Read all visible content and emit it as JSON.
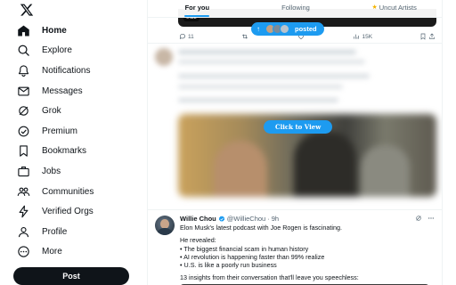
{
  "sidebar": {
    "items": [
      {
        "label": "Home",
        "icon": "home-icon"
      },
      {
        "label": "Explore",
        "icon": "search-icon"
      },
      {
        "label": "Notifications",
        "icon": "bell-icon"
      },
      {
        "label": "Messages",
        "icon": "envelope-icon"
      },
      {
        "label": "Grok",
        "icon": "grok-icon"
      },
      {
        "label": "Premium",
        "icon": "premium-icon"
      },
      {
        "label": "Bookmarks",
        "icon": "bookmark-icon"
      },
      {
        "label": "Jobs",
        "icon": "briefcase-icon"
      },
      {
        "label": "Communities",
        "icon": "communities-icon"
      },
      {
        "label": "Verified Orgs",
        "icon": "lightning-icon"
      },
      {
        "label": "Profile",
        "icon": "person-icon"
      },
      {
        "label": "More",
        "icon": "more-circle-icon"
      }
    ],
    "post_label": "Post"
  },
  "tabs": [
    {
      "label": "For you",
      "active": true
    },
    {
      "label": "Following",
      "active": false
    },
    {
      "label": "Uncut Artists",
      "active": false
    }
  ],
  "feed": {
    "video_time": "0:38",
    "posted_label": "posted",
    "top_actions": {
      "replies": "11",
      "retweets": "",
      "likes": "",
      "views": "15K"
    },
    "click_to_view": "Click to View",
    "tweet": {
      "name": "Willie Chou",
      "handle": "@WillieChou",
      "dot": "·",
      "time": "9h",
      "lines": [
        "Elon Musk's latest podcast with Joe Rogen is fascinating.",
        "He revealed:",
        "• The biggest financial scam in human history",
        "• AI revolution is happening faster than 99% realize",
        "• U.S. is like a poorly run business",
        "13 insights from their conversation that'll leave you speechless:"
      ]
    }
  },
  "colors": {
    "accent": "#1d9bf0",
    "text": "#0f1419",
    "muted": "#536471"
  }
}
